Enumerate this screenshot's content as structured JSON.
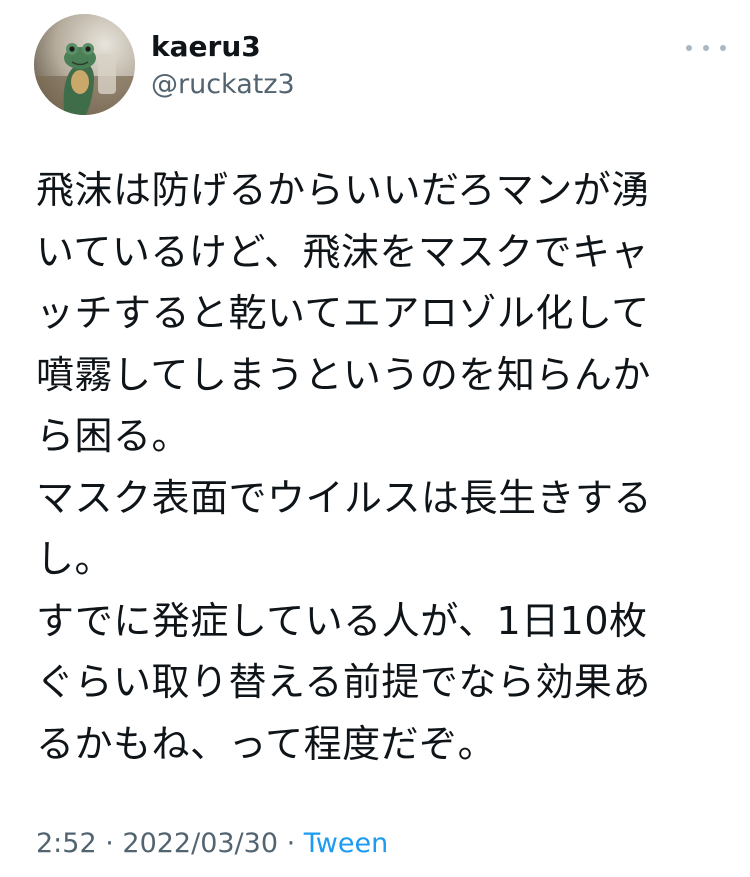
{
  "user": {
    "display_name": "kaeru3",
    "handle": "@ruckatz3",
    "avatar_icon": "frog-figurine-avatar"
  },
  "more_icon": "more-options-icon",
  "tweet": {
    "lines": [
      "飛沫は防げるからいいだろマンが湧",
      "いているけど、飛沫をマスクでキャ",
      "ッチすると乾いてエアロゾル化して",
      "噴霧してしまうというのを知らんか",
      "ら困る。",
      "マスク表面でウイルスは長生きする",
      "し。",
      "すでに発症している人が、1日10枚",
      "ぐらい取り替える前提でなら効果あ",
      "るかもね、って程度だぞ。"
    ]
  },
  "meta": {
    "time": "2:52",
    "separator": " · ",
    "date": "2022/03/30",
    "source": "Tween"
  },
  "colors": {
    "text": "#0f1419",
    "secondary": "#536471",
    "link": "#1d9bf0"
  }
}
